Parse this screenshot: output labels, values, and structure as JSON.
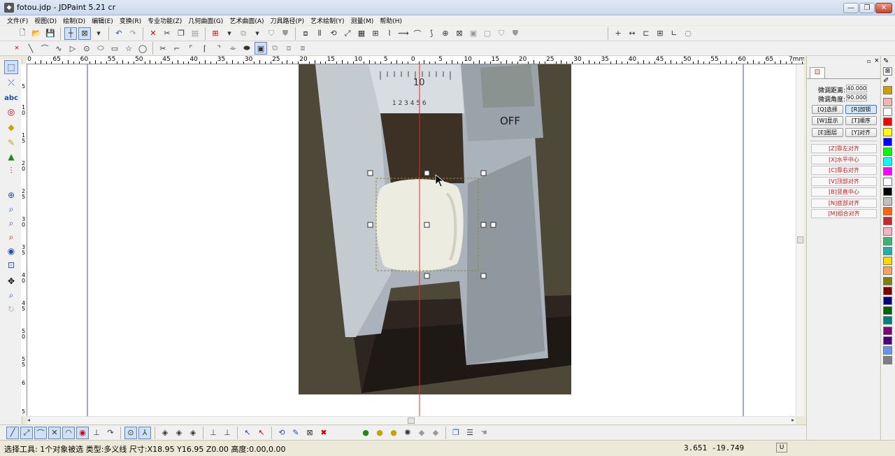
{
  "window": {
    "title": "fotou.jdp - JDPaint 5.21 cr",
    "minimize": "—",
    "restore": "❐",
    "close": "✕"
  },
  "menu": [
    "文件(F)",
    "视图(D)",
    "绘制(D)",
    "编辑(E)",
    "变换(R)",
    "专业功能(Z)",
    "几何曲面(G)",
    "艺术曲面(A)",
    "刀具路径(P)",
    "艺术绘制(Y)",
    "测量(M)",
    "帮助(H)"
  ],
  "toolbar1": {
    "file_tools": [
      "new-file-icon",
      "open-folder-icon",
      "save-icon"
    ],
    "select_tools": [
      "point-select-icon",
      "box-select-icon",
      "dropdown-icon"
    ],
    "edit_tools": [
      "undo-icon",
      "redo-icon",
      "delete-icon",
      "cut-icon",
      "copy-icon",
      "paste-icon"
    ],
    "right_tools": [
      "measure-point-icon",
      "measure-distance-icon",
      "measure-angle-icon",
      "measure-area-icon",
      "measure-curve-icon",
      "measure-profile-icon"
    ]
  },
  "toolbar2": {
    "draw_tools": [
      "point-icon",
      "line-icon",
      "arc-icon",
      "spline-icon",
      "polyline-icon",
      "circle-icon",
      "ellipse-icon",
      "rectangle-icon",
      "star-icon",
      "polygon-icon"
    ]
  },
  "left_tools": [
    "select-tool-icon",
    "node-edit-icon",
    "text-tool-icon",
    "shape-tool-icon",
    "fill-tool-icon",
    "pen-tool-icon",
    "color-tool-icon",
    "measure-tool-icon",
    "zoom-in-icon",
    "zoom-window-icon",
    "zoom-out-icon",
    "zoom-curve-icon",
    "eye-icon",
    "zoom-fit-icon",
    "pan-icon",
    "zoom-icon",
    "rotate-view-icon"
  ],
  "ruler": {
    "h_labels": [
      "0",
      "65",
      "60",
      "55",
      "50",
      "45",
      "40",
      "35",
      "30",
      "25",
      "20",
      "15",
      "10",
      "5",
      "0",
      "5",
      "10",
      "15",
      "20",
      "25",
      "30",
      "35",
      "40",
      "45",
      "50",
      "55",
      "60",
      "65",
      "7mm"
    ],
    "v_labels": [
      "5",
      "1",
      "0",
      "1",
      "5",
      "2",
      "0",
      "2",
      "5",
      "3",
      "0",
      "3",
      "5",
      "4",
      "0",
      "4",
      "5",
      "5",
      "0",
      "5",
      "5",
      "6",
      "5"
    ]
  },
  "canvas": {
    "caliper_reading": "OFF",
    "scale_number": "10",
    "scale_digits": "1 2 3 4 5 6"
  },
  "right_panel": {
    "fine_distance_label": "微调距离:",
    "fine_distance_value": "40.000",
    "fine_angle_label": "微调角度:",
    "fine_angle_value": "90.000",
    "buttons": [
      "[Q]选择",
      "[R]加锁",
      "[W]显示",
      "[T]顺序",
      "[E]图层",
      "[Y]对齐"
    ],
    "align_buttons": [
      "[Z]靠左对齐",
      "[X]水平中心",
      "[C]靠右对齐",
      "[V]顶部对齐",
      "[B]竖直中心",
      "[N]底部对齐",
      "[M]组合对齐"
    ]
  },
  "palette": [
    "#f2b3b3",
    "#ffffff",
    "#ff0000",
    "#ffff00",
    "#0000ff",
    "#00ff00",
    "#00ffff",
    "#ff00ff",
    "#ffffff",
    "#000000",
    "#c0c0c0",
    "#ff6600",
    "#c8282d",
    "#f9b3c0",
    "#3cb371",
    "#20b2aa",
    "#ffd700",
    "#f4a460",
    "#808000",
    "#800000",
    "#000080",
    "#006400",
    "#008080",
    "#800080",
    "#4b0082",
    "#6495ed",
    "#808080"
  ],
  "bottom_tools": [
    "snap-line-icon",
    "snap-node-icon",
    "snap-tangent-icon",
    "snap-intersect-icon",
    "snap-arc-icon",
    "snap-circle-icon",
    "snap-perp-icon",
    "snap-curve-icon",
    "snap-center-icon",
    "snap-angle-icon",
    "grid-icon",
    "grid-node-icon",
    "grid-toggle-icon",
    "plane-icon",
    "plane2-icon",
    "cursor-icon",
    "cursor-x-icon",
    "rotate-icon",
    "edit-icon",
    "view-icon",
    "cancel-icon",
    "light1-icon",
    "light2-icon",
    "light3-icon",
    "light4-icon",
    "light5-icon",
    "light6-icon",
    "copy-view-icon",
    "layers-icon",
    "hand-icon"
  ],
  "status": {
    "text": "选择工具: 1个对象被选 类型:多义线 尺寸:X18.95 Y16.95 Z0.00 高度:0.00,0.00",
    "coords": "3.651  -19.749",
    "mode": "U"
  }
}
